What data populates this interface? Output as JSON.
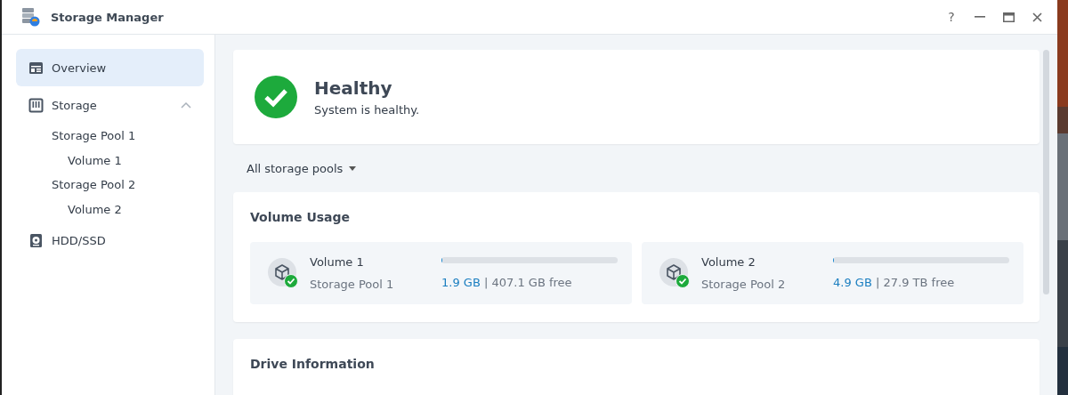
{
  "window": {
    "title": "Storage Manager",
    "buttons": [
      {
        "kind": "help",
        "label": "?"
      },
      {
        "kind": "minimize"
      },
      {
        "kind": "maximize"
      },
      {
        "kind": "close"
      }
    ]
  },
  "sidebar": {
    "items": [
      {
        "label": "Overview",
        "kind": "overview",
        "selected": true
      },
      {
        "label": "Storage",
        "kind": "storage",
        "selected": false,
        "expanded": true,
        "children": [
          {
            "label": "Storage Pool 1",
            "selected": false,
            "children": [
              {
                "label": "Volume 1",
                "selected": false
              }
            ]
          },
          {
            "label": "Storage Pool 2",
            "selected": false,
            "children": [
              {
                "label": "Volume 2",
                "selected": false
              }
            ]
          }
        ]
      },
      {
        "label": "HDD/SSD",
        "kind": "drive",
        "selected": false
      }
    ]
  },
  "status": {
    "healthy": true,
    "title": "Healthy",
    "message": "System is healthy."
  },
  "filter": {
    "label": "All storage pools"
  },
  "volume_usage": {
    "title": "Volume Usage",
    "volumes": [
      {
        "name": "Volume 1",
        "pool": "Storage Pool 1",
        "healthy": true,
        "level": 0.005,
        "used": "1.9 GB",
        "separator": "|",
        "free": "407.1 GB free"
      },
      {
        "name": "Volume 2",
        "pool": "Storage Pool 2",
        "healthy": true,
        "level": 0.0002,
        "used": "4.9 GB",
        "separator": "|",
        "free": "27.9 TB free"
      }
    ]
  },
  "drive_information": {
    "title": "Drive Information"
  }
}
